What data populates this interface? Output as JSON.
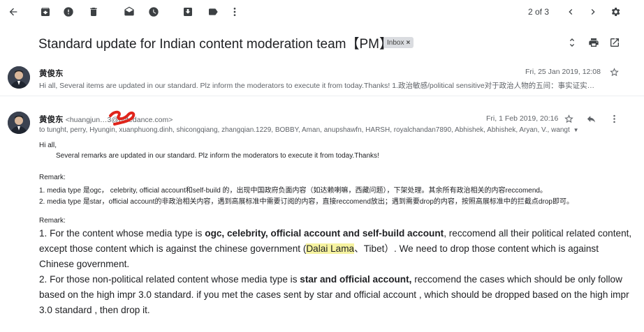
{
  "toolbar": {
    "icons": [
      "back-arrow-icon",
      "archive-icon",
      "report-spam-icon",
      "delete-icon",
      "mark-unread-icon",
      "snooze-icon",
      "add-to-tasks-icon",
      "label-icon",
      "more-vert-icon"
    ],
    "pager": "2 of 3"
  },
  "thread": {
    "subject": "Standard update for Indian content moderation team【PM】",
    "label": "Inbox"
  },
  "message1": {
    "sender": "黄俊东",
    "snippet": "Hi all, Several items are updated in our standard. Plz inform the moderators to execute it from today.Thanks! 1.政治敏感/political sensitive对于政治人物的五间：事实证实…",
    "date": "Fri, 25 Jan 2019, 12:08"
  },
  "message2": {
    "sender": "黄俊东",
    "sender_email": "<huangjun…3@bytedance.com>",
    "date": "Fri, 1 Feb 2019, 20:16",
    "recipients": "to tunght, perry, Hyungin, xuanphuong.dinh, shicongqiang, zhangqian.1229, BOBBY, Aman, anupshawfn, HARSH, royalchandan7890, Abhishek, Abhishek, Aryan, V., wangt",
    "greeting": "Hi all,",
    "intro": "Several remarks are updated in our standard. Plz inform the moderators to execute it from today.Thanks!",
    "remark_label": "Remark:",
    "remark_cn_1": "1. media type 是ogc， celebrity,   official account和self-build 的，出现中国政府负面内容（如达赖喇嘛，西藏问题），下架处理。其余所有政治相关的内容reccomend。",
    "remark_cn_2": "2. media type 是star，official account的非政治相关内容，遇到高展标准中需要订阅的内容，直接reccomend放出；遇到需要drop的内容，按照高展标准中的拦截点drop即可。",
    "remark_label_2": "Remark:",
    "p1_a": "1. For the content whose media type is ",
    "p1_b": "ogc, celebrity, official account and self-build account",
    "p1_c": ", reccomend all their political related content, except those content which is against the chinese government (",
    "p1_hl": "Dalai Lama",
    "p1_d": "、Tibet）. We need to drop those content which is against Chinese government.",
    "p2_a": "2. For those non-political related content whose media type is ",
    "p2_b": "star and official account,",
    "p2_c": " reccomend the cases which should be only follow based on the high impr 3.0 standard. if you met the cases sent by star and official account , which should be dropped based on the high impr 3.0 standard , then drop it."
  }
}
